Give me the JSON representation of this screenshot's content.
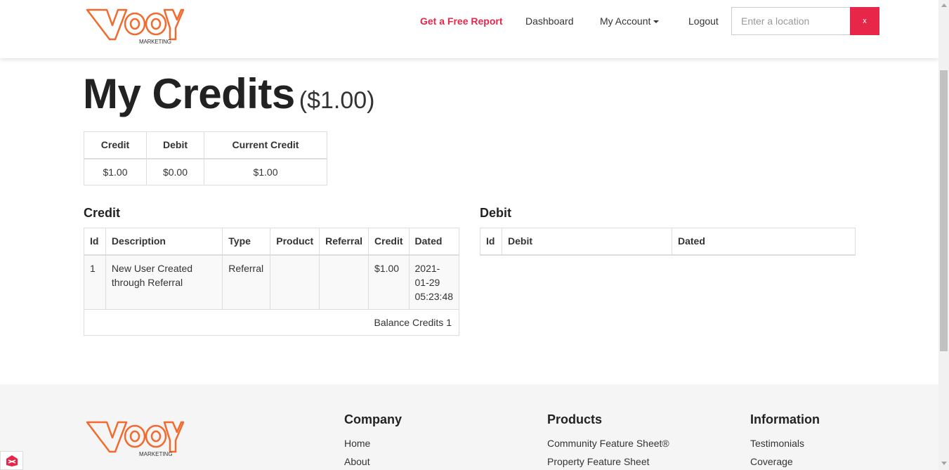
{
  "header": {
    "logo_text": "VOOY",
    "logo_tag": "MARKETING",
    "nav": {
      "free_report": "Get a Free Report",
      "dashboard": "Dashboard",
      "my_account": "My Account",
      "logout": "Logout"
    },
    "search": {
      "placeholder": "Enter a location",
      "value": ""
    },
    "search_button": "x"
  },
  "page": {
    "title": "My Credits",
    "title_amount": "($1.00)"
  },
  "summary": {
    "headers": [
      "Credit",
      "Debit",
      "Current Credit"
    ],
    "values": [
      "$1.00",
      "$0.00",
      "$1.00"
    ]
  },
  "credit_section": {
    "title": "Credit",
    "headers": [
      "Id",
      "Description",
      "Type",
      "Product",
      "Referral",
      "Credit",
      "Dated"
    ],
    "rows": [
      {
        "id": "1",
        "description": "New User Created through Referral",
        "type": "Referral",
        "product": "",
        "referral": "",
        "credit": "$1.00",
        "dated": "2021-01-29 05:23:48"
      }
    ],
    "balance": "Balance Credits 1"
  },
  "debit_section": {
    "title": "Debit",
    "headers": [
      "Id",
      "Debit",
      "Dated"
    ]
  },
  "footer": {
    "company": {
      "title": "Company",
      "links": [
        "Home",
        "About"
      ]
    },
    "products": {
      "title": "Products",
      "links": [
        "Community Feature Sheet®",
        "Property Feature Sheet"
      ]
    },
    "information": {
      "title": "Information",
      "links": [
        "Testimonials",
        "Coverage"
      ]
    }
  },
  "colors": {
    "accent": "#e8264a",
    "logo": "#f26a2e"
  }
}
